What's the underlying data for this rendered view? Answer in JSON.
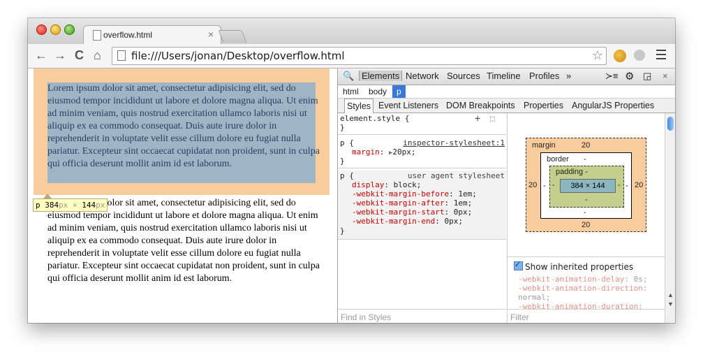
{
  "browser": {
    "tab_title": "overflow.html",
    "tab_close": "×",
    "url": "file:///Users/jonan/Desktop/overflow.html",
    "nav": {
      "back": "←",
      "forward": "→",
      "reload": "C",
      "home": "⌂"
    },
    "star": "☆"
  },
  "page": {
    "paragraph1": "Lorem ipsum dolor sit amet, consectetur adipisicing elit, sed do eiusmod tempor incididunt ut labore et dolore magna aliqua. Ut enim ad minim veniam, quis nostrud exercitation ullamco laboris nisi ut aliquip ex ea commodo consequat. Duis aute irure dolor in reprehenderit in voluptate velit esse cillum dolore eu fugiat nulla pariatur. Excepteur sint occaecat cupidatat non proident, sunt in culpa qui officia deserunt mollit anim id est laborum.",
    "paragraph2": "Lorem ipsum dolor sit amet, consectetur adipisicing elit, sed do eiusmod tempor incididunt ut labore et dolore magna aliqua. Ut enim ad minim veniam, quis nostrud exercitation ullamco laboris nisi ut aliquip ex ea commodo consequat. Duis aute irure dolor in reprehenderit in voluptate velit esse cillum dolore eu fugiat nulla pariatur. Excepteur sint occaecat cupidatat non proident, sunt in culpa qui officia deserunt mollit anim id est laborum.",
    "tooltip": {
      "tag": "p",
      "width": "384",
      "px1": "px",
      "times": "×",
      "height": "144",
      "px2": "px"
    }
  },
  "devtools": {
    "top_tabs": [
      "Elements",
      "Network",
      "Sources",
      "Timeline",
      "Profiles"
    ],
    "more": "»",
    "console_icon": "≻≡",
    "settings_icon": "⚙",
    "dock_icon": "◲",
    "close": "×",
    "breadcrumbs": [
      "html",
      "body",
      "p"
    ],
    "subtabs": [
      "Styles",
      "Event Listeners",
      "DOM Breakpoints",
      "Properties",
      "AngularJS Properties"
    ],
    "element_style": {
      "selector": "element.style {",
      "close": "}",
      "add": "+",
      "toggle": "⬚"
    },
    "rule1": {
      "selector": "p {",
      "source": "inspector-stylesheet:1",
      "prop": "margin",
      "value": "20px;",
      "close": "}"
    },
    "rule2": {
      "selector": "p {",
      "source": "user agent stylesheet",
      "props": [
        {
          "name": "display",
          "value": "block;"
        },
        {
          "name": "-webkit-margin-before",
          "value": "1em;"
        },
        {
          "name": "-webkit-margin-after",
          "value": "1em;"
        },
        {
          "name": "-webkit-margin-start",
          "value": "0px;"
        },
        {
          "name": "-webkit-margin-end",
          "value": "0px;"
        }
      ],
      "close": "}"
    },
    "find_placeholder": "Find in Styles",
    "box_model": {
      "margin_label": "margin",
      "margin_top": "20",
      "margin_bottom": "20",
      "margin_left": "20",
      "margin_right": "20",
      "border_label": "border",
      "border_top": "-",
      "border_bottom": "-",
      "border_left": "-",
      "border_right": "-",
      "padding_label": "padding -",
      "padding_bottom": "-",
      "padding_left": "-",
      "padding_right": "-",
      "content": "384 × 144"
    },
    "show_inherited": "Show inherited properties",
    "inherited": [
      {
        "name": "-webkit-animation-delay:",
        "value": "0s;"
      },
      {
        "name": "-webkit-animation-direction:",
        "value": "normal;"
      },
      {
        "name": "-webkit-animation-duration:",
        "value": ""
      }
    ],
    "filter_placeholder": "Filter"
  },
  "colors": {
    "margin": "#f9cc9d",
    "content_highlight": "#6fa8dc",
    "padding": "#c3cf8a",
    "selected": "#3879d9",
    "property": "#c80000"
  }
}
